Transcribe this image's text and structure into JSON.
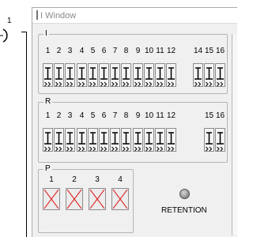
{
  "window": {
    "title": "I Window"
  },
  "background": {
    "coil_label": "1"
  },
  "groups": {
    "I": {
      "label": "I",
      "switches": [
        "1",
        "2",
        "3",
        "4",
        "5",
        "6",
        "7",
        "8",
        "9",
        "10",
        "11",
        "12",
        "14",
        "15",
        "16"
      ]
    },
    "R": {
      "label": "R",
      "switches": [
        "1",
        "2",
        "3",
        "4",
        "5",
        "6",
        "7",
        "8",
        "9",
        "10",
        "11",
        "12",
        "15",
        "16"
      ]
    },
    "P": {
      "label": "P",
      "items": [
        "1",
        "2",
        "3",
        "4"
      ]
    }
  },
  "retention": {
    "label": "RETENTION"
  }
}
